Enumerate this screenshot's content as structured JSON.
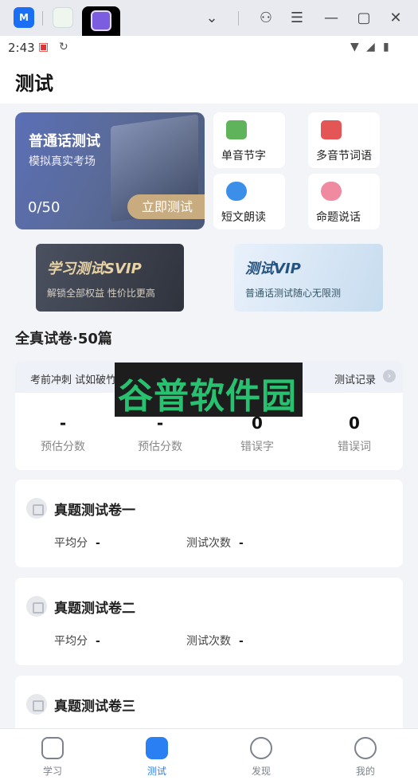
{
  "window_bar": {
    "app1_label": "M"
  },
  "status": {
    "time": "2:43"
  },
  "header": {
    "title": "测试"
  },
  "hero": {
    "title": "普通话测试",
    "subtitle": "模拟真实考场",
    "progress": "0/50",
    "button": "立即测试"
  },
  "categories": [
    {
      "label": "单音节字",
      "color": "#5fb35a"
    },
    {
      "label": "多音节词语",
      "color": "#e45555"
    },
    {
      "label": "短文朗读",
      "color": "#3b8fe8"
    },
    {
      "label": "命题说话",
      "color": "#f08aa0"
    }
  ],
  "banners": [
    {
      "title": "学习测试SVIP",
      "subtitle": "解锁全部权益 性价比更高"
    },
    {
      "title": "测试VIP",
      "subtitle": "普通话测试随心无限测"
    }
  ],
  "section_title": "全真试卷·50篇",
  "stats": {
    "slogan": "考前冲刺 试如破竹",
    "record": "测试记录",
    "items": [
      {
        "value": "-",
        "label": "预估分数"
      },
      {
        "value": "-",
        "label": "预估分数"
      },
      {
        "value": "0",
        "label": "错误字"
      },
      {
        "value": "0",
        "label": "错误词"
      }
    ]
  },
  "papers": [
    {
      "title": "真题测试卷一",
      "avg_label": "平均分",
      "avg_value": "-",
      "count_label": "测试次数",
      "count_value": "-"
    },
    {
      "title": "真题测试卷二",
      "avg_label": "平均分",
      "avg_value": "-",
      "count_label": "测试次数",
      "count_value": "-"
    },
    {
      "title": "真题测试卷三"
    }
  ],
  "watermark": "谷普软件园",
  "nav": [
    {
      "label": "学习"
    },
    {
      "label": "测试"
    },
    {
      "label": "发现"
    },
    {
      "label": "我的"
    }
  ]
}
